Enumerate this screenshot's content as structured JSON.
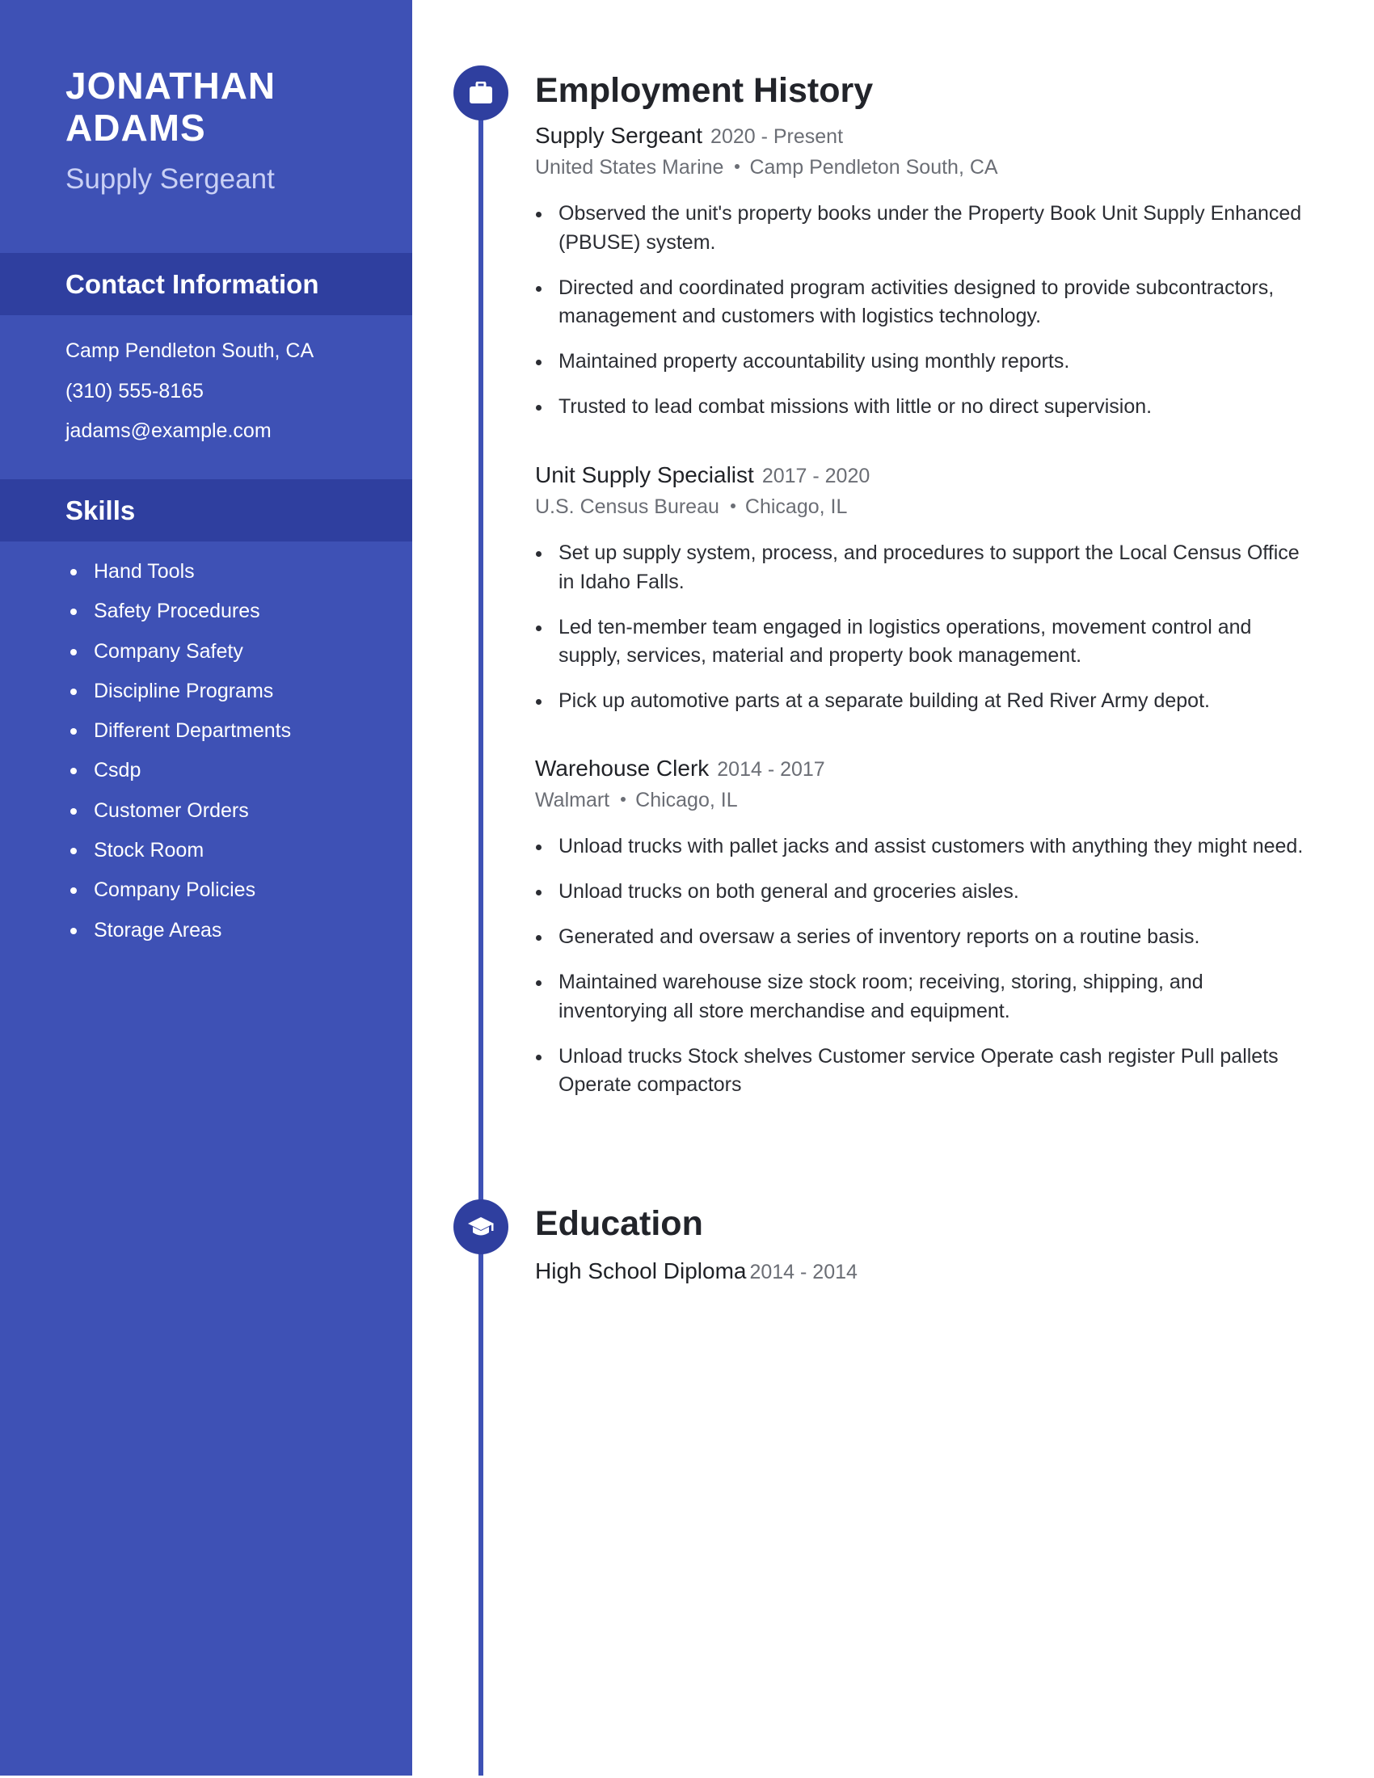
{
  "colors": {
    "sidebar": "#3e51b5",
    "sidebar_band": "#2f3f9f",
    "accent": "#3e51b5",
    "icon_bg": "#2f3f9f",
    "heading_text": "#22242a",
    "muted_text": "#6b6e75"
  },
  "profile": {
    "first_name": "JONATHAN",
    "last_name": "ADAMS",
    "title": "Supply Sergeant"
  },
  "contact": {
    "heading": "Contact Information",
    "items": [
      "Camp Pendleton South, CA",
      "(310) 555-8165",
      "jadams@example.com"
    ]
  },
  "skills": {
    "heading": "Skills",
    "items": [
      "Hand Tools",
      "Safety Procedures",
      "Company Safety",
      "Discipline Programs",
      "Different Departments",
      "Csdp",
      "Customer Orders",
      "Stock Room",
      "Company Policies",
      "Storage Areas"
    ]
  },
  "employment": {
    "heading": "Employment History",
    "icon": "briefcase-icon",
    "jobs": [
      {
        "role": "Supply Sergeant",
        "dates": "2020 - Present",
        "employer": "United States Marine",
        "location": "Camp Pendleton South, CA",
        "bullets": [
          "Observed the unit's property books under the Property Book Unit Supply Enhanced (PBUSE) system.",
          "Directed and coordinated program activities designed to provide subcontractors, management and customers with logistics technology.",
          "Maintained property accountability using monthly reports.",
          "Trusted to lead combat missions with little or no direct supervision."
        ]
      },
      {
        "role": "Unit Supply Specialist",
        "dates": "2017 - 2020",
        "employer": "U.S. Census Bureau",
        "location": "Chicago, IL",
        "bullets": [
          "Set up supply system, process, and procedures to support the Local Census Office in Idaho Falls.",
          "Led ten-member team engaged in logistics operations, movement control and supply, services, material and property book management.",
          "Pick up automotive parts at a separate building at Red River Army depot."
        ]
      },
      {
        "role": "Warehouse Clerk",
        "dates": "2014 - 2017",
        "employer": "Walmart",
        "location": "Chicago, IL",
        "bullets": [
          "Unload trucks with pallet jacks and assist customers with anything they might need.",
          "Unload trucks on both general and groceries aisles.",
          "Generated and oversaw a series of inventory reports on a routine basis.",
          "Maintained warehouse size stock room; receiving, storing, shipping, and inventorying all store merchandise and equipment.",
          "Unload trucks Stock shelves Customer service Operate cash register Pull pallets Operate compactors"
        ]
      }
    ]
  },
  "education": {
    "heading": "Education",
    "icon": "graduation-cap-icon",
    "entries": [
      {
        "degree": "High School Diploma",
        "dates": "2014 - 2014"
      }
    ]
  }
}
